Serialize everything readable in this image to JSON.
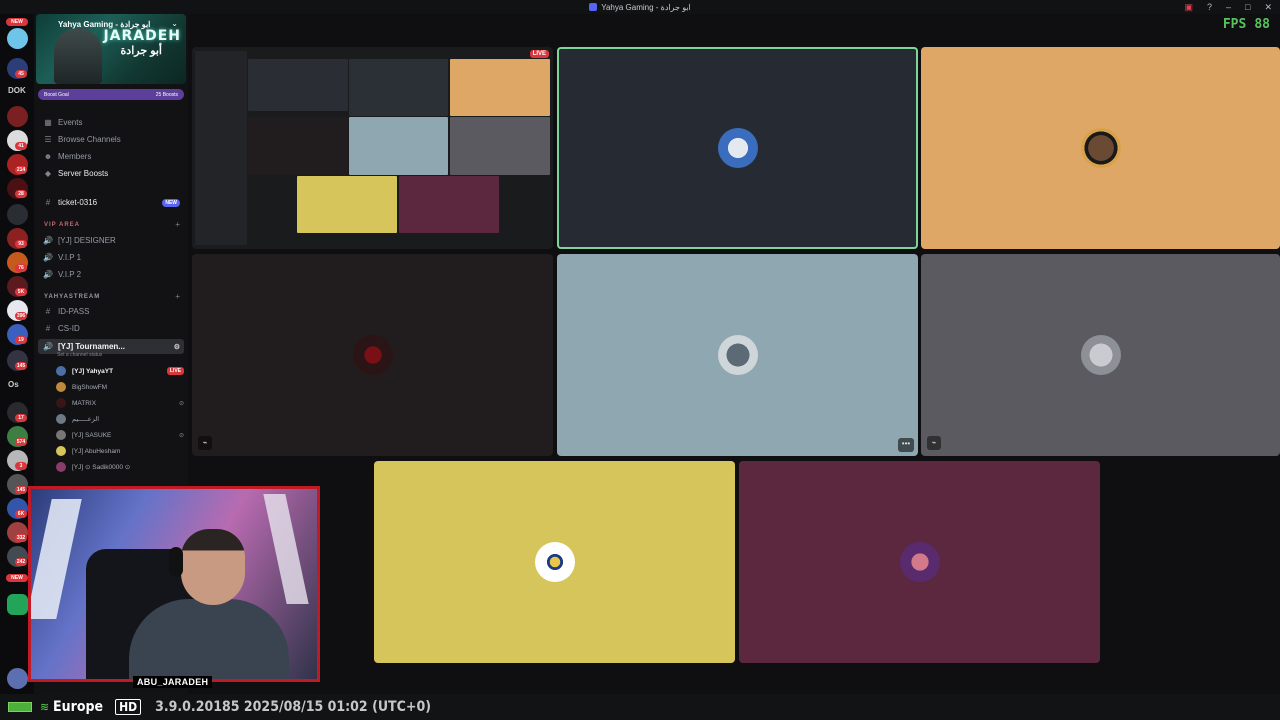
{
  "window": {
    "title": "Yahya Gaming - ابو جرادة"
  },
  "fps": {
    "label": "FPS",
    "value": "88"
  },
  "server_rail": {
    "badges": [
      "NEW",
      "45",
      "41",
      "214",
      "28",
      "93",
      "76",
      "5K",
      "396",
      "19",
      "145",
      "17",
      "574",
      "3",
      "145",
      "6K",
      "332",
      "242",
      "NEW"
    ],
    "texts": [
      "DOK",
      "Os"
    ]
  },
  "sidebar": {
    "server_name": "Yahya Gaming - ابو جرادة",
    "banner_brand": "JARADEH",
    "banner_brand_ar": "أبو جرادة",
    "boost_goal": "Boost Goal",
    "boost_count": "25 Boosts",
    "nav": [
      {
        "label": "Events",
        "icon": "calendar-icon"
      },
      {
        "label": "Browse Channels",
        "icon": "browse-icon"
      },
      {
        "label": "Members",
        "icon": "members-icon"
      },
      {
        "label": "Server Boosts",
        "icon": "boost-icon"
      }
    ],
    "ticket": {
      "label": "ticket-0316",
      "badge": "NEW"
    },
    "cat_vip": "VIP AREA",
    "vip_channels": [
      "[YJ] DESIGNER",
      "V.I.P 1",
      "V.I.P 2"
    ],
    "cat_stream": "YAHYASTREAM",
    "stream_channels": [
      "ID-PASS",
      "CS-ID"
    ],
    "active_voice": {
      "label": "[YJ] Tournamen...",
      "status": "Set a channel status"
    },
    "users": [
      {
        "name": "[YJ] YahyaYT",
        "tag": "LIVE"
      },
      {
        "name": "BigShowFM",
        "tag": ""
      },
      {
        "name": "MATRIX",
        "tag": ""
      },
      {
        "name": "الزعـــــيم",
        "tag": ""
      },
      {
        "name": "[YJ] SASUKE",
        "tag": ""
      },
      {
        "name": "[YJ] AbuHesham",
        "tag": ""
      },
      {
        "name": "[YJ] ⊙ Sadik0000 ⊙",
        "tag": ""
      }
    ]
  },
  "webcam": {
    "label": "ABU_JARADEH"
  },
  "stream_tile": {
    "badge": "LIVE"
  },
  "statusbar": {
    "region": "Europe",
    "quality": "HD",
    "version": "3.9.0.20185 2025/08/15 01:02 (UTC+0)"
  },
  "colors": {
    "tile_dark": "#262b33",
    "tile_orange": "#dfa765",
    "tile_black": "#211c1e",
    "tile_blue": "#8fa7b0",
    "tile_gray": "#5a5a60",
    "tile_yellow": "#d6c55b",
    "tile_maroon": "#5c2840",
    "speaking": "#7fd49a",
    "live": "#da373c",
    "fps": "#58c35e"
  }
}
